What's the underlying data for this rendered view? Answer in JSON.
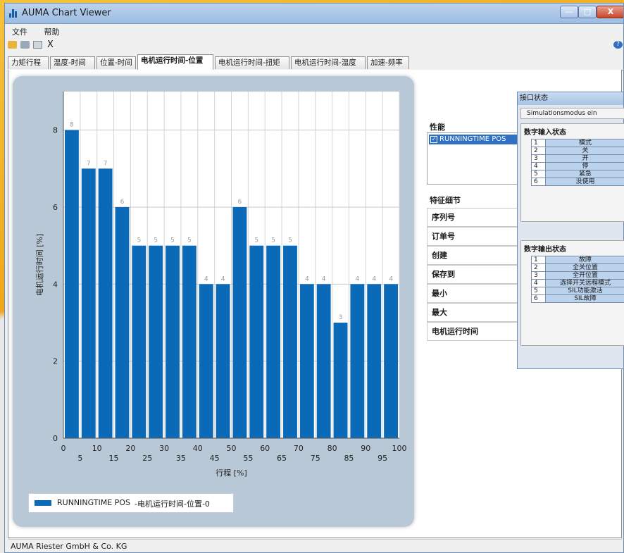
{
  "window": {
    "title": "AUMA Chart Viewer",
    "minimize": "—",
    "maximize": "□",
    "close": "X"
  },
  "menu": [
    "文件",
    "帮助"
  ],
  "toolbar": {
    "icons": [
      "open-folder-icon",
      "save-icon",
      "print-icon",
      "close-icon"
    ],
    "close_glyph": "X",
    "help_glyph": "?"
  },
  "tabs": [
    "力矩行程",
    "温度-时间",
    "位置-时间",
    "电机运行时间-位置",
    "电机运行时间-扭矩",
    "电机运行时间-温度",
    "加速-频率"
  ],
  "active_tab": 3,
  "chart_data": {
    "type": "bar",
    "x": [
      0,
      5,
      10,
      15,
      20,
      25,
      30,
      35,
      40,
      45,
      50,
      55,
      60,
      65,
      70,
      75,
      80,
      85,
      90,
      95
    ],
    "values": [
      8,
      7,
      7,
      6,
      5,
      5,
      5,
      5,
      4,
      4,
      6,
      5,
      5,
      5,
      4,
      4,
      3,
      4,
      4,
      4
    ],
    "series_name": "RUNNINGTIME POS",
    "xlabel": "行程 [%]",
    "ylabel": "电机运行时间 [%]",
    "xlim": [
      0,
      100
    ],
    "ylim": [
      0,
      9
    ],
    "yticks": [
      0,
      2,
      4,
      6,
      8
    ],
    "xticks_top": [
      0,
      10,
      20,
      30,
      40,
      50,
      60,
      70,
      80,
      90,
      100
    ],
    "xticks_bottom": [
      5,
      15,
      25,
      35,
      45,
      55,
      65,
      75,
      85,
      95
    ],
    "grid": true,
    "bar_color": "#0a6ab8",
    "legend": {
      "entry": "RUNNINGTIME POS",
      "extra": "-电机运行时间-位置-0",
      "placement": "bottom-left"
    }
  },
  "performance": {
    "label": "性能",
    "item": "RUNNINGTIME POS",
    "checked": "✓"
  },
  "features": {
    "label": "特征细节",
    "rows": [
      "序列号",
      "订单号",
      "创建",
      "保存到",
      "最小",
      "最大",
      "电机运行时间"
    ]
  },
  "interface": {
    "title": "接口状态",
    "mode": "Simulationsmodus ein",
    "inputs": {
      "title": "数字输入状态",
      "rows": [
        [
          "1",
          "模式"
        ],
        [
          "2",
          "关"
        ],
        [
          "3",
          "开"
        ],
        [
          "4",
          "停"
        ],
        [
          "5",
          "紧急"
        ],
        [
          "6",
          "没使用"
        ]
      ]
    },
    "outputs": {
      "title": "数字输出状态",
      "rows": [
        [
          "1",
          "故障"
        ],
        [
          "2",
          "全关位置"
        ],
        [
          "3",
          "全开位置"
        ],
        [
          "4",
          "选择开关远程模式"
        ],
        [
          "5",
          "SIL功能激活"
        ],
        [
          "6",
          "SIL故障"
        ]
      ]
    }
  },
  "status": {
    "text": "AUMA Riester GmbH & Co. KG"
  }
}
